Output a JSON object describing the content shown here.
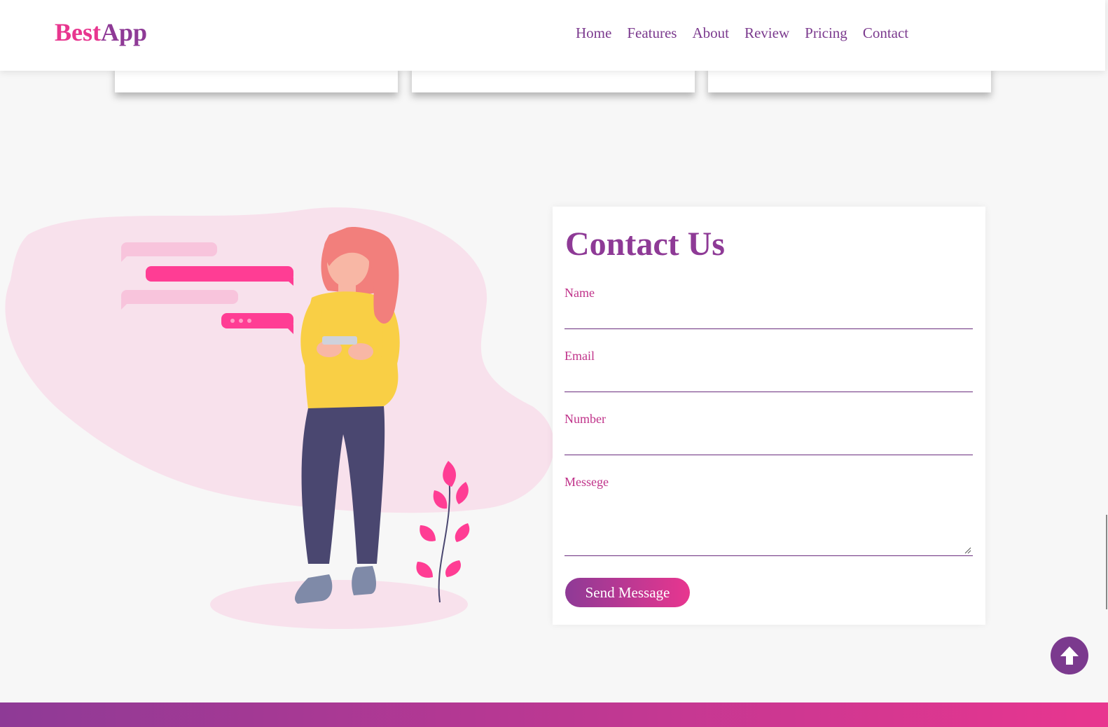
{
  "brand": {
    "part1": "Best",
    "part2": "App",
    "color1": "#e8368f",
    "color2": "#8e3a96"
  },
  "nav": {
    "items": [
      {
        "label": "Home"
      },
      {
        "label": "Features"
      },
      {
        "label": "About"
      },
      {
        "label": "Review"
      },
      {
        "label": "Pricing"
      },
      {
        "label": "Contact"
      }
    ]
  },
  "contact": {
    "title": "Contact Us",
    "fields": {
      "name": {
        "label": "Name",
        "value": ""
      },
      "email": {
        "label": "Email",
        "value": ""
      },
      "number": {
        "label": "Number",
        "value": ""
      },
      "message": {
        "label": "Messege",
        "value": ""
      }
    },
    "submit_label": "Send Message"
  },
  "icons": {
    "scroll_top": "arrow-up-circle-icon"
  },
  "colors": {
    "accent_pink": "#e8368f",
    "accent_purple": "#8e3a96"
  }
}
